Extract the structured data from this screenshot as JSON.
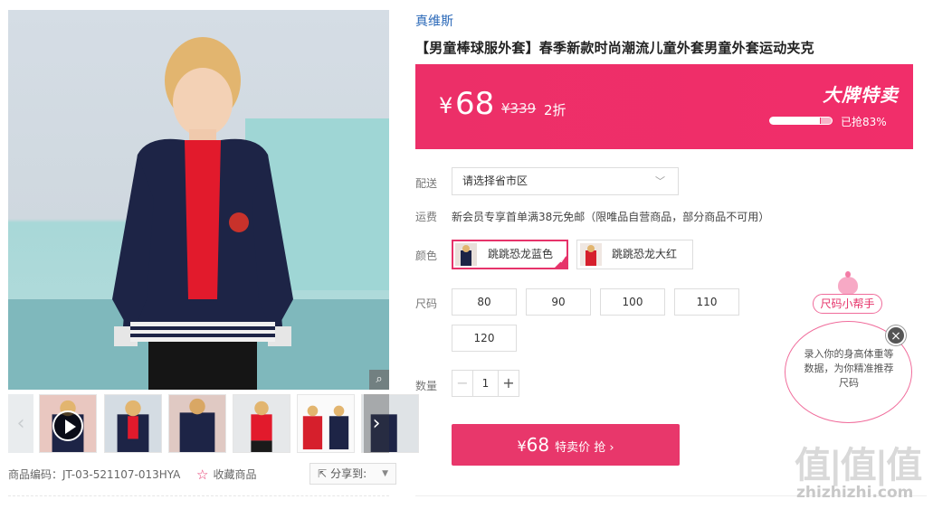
{
  "product": {
    "brand": "真维斯",
    "title": "【男童棒球服外套】春季新款时尚潮流儿童外套男童外套运动夹克",
    "sku_label": "商品编码：JT-03-521107-013HYA",
    "favorite_label": "收藏商品",
    "share_label": "分享到:"
  },
  "price_panel": {
    "currency": "¥",
    "price": "68",
    "original_price": "¥339",
    "discount": "2折",
    "promo_title": "大牌特卖",
    "sold_label": "已抢83%",
    "sold_percent": 83,
    "color_bg": "#ec2f68"
  },
  "delivery": {
    "label": "配送",
    "placeholder": "请选择省市区"
  },
  "shipping": {
    "label": "运费",
    "note": "新会员专享首单满38元免邮（限唯品自营商品，部分商品不可用）"
  },
  "colors": {
    "label": "颜色",
    "options": [
      {
        "name": "跳跳恐龙蓝色",
        "selected": true
      },
      {
        "name": "跳跳恐龙大红",
        "selected": false
      }
    ]
  },
  "sizes": {
    "label": "尺码",
    "options": [
      "80",
      "90",
      "100",
      "110",
      "120"
    ]
  },
  "quantity": {
    "label": "数量",
    "value": "1",
    "minus": "−",
    "plus": "+"
  },
  "buy_button": {
    "currency": "¥",
    "price": "68",
    "text": "特卖价 抢 ›"
  },
  "size_helper": {
    "tag": "尺码小帮手",
    "text": "录入你的身高体重等数据，为你精准推荐尺码",
    "close": "×"
  },
  "watermark": {
    "logo": "值|值|值",
    "url": "zhizhizhi.com"
  },
  "icons": {
    "zoom": "zoom-icon",
    "play": "play-icon",
    "star": "star-icon",
    "share": "share-icon"
  }
}
